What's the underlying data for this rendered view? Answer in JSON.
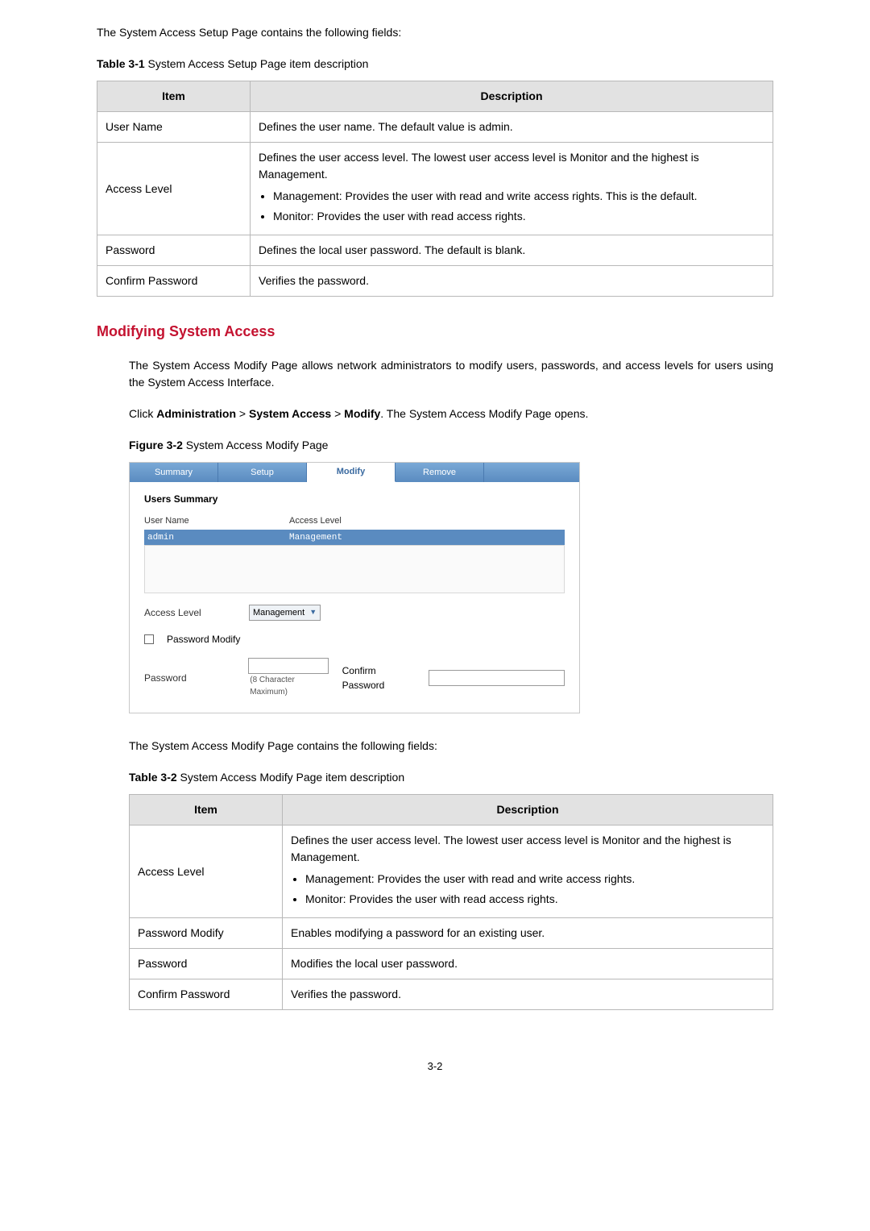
{
  "intro1": "The System Access Setup Page contains the following fields:",
  "tbl1_caption_strong": "Table 3-1",
  "tbl1_caption_rest": " System Access Setup Page item description",
  "col_item": "Item",
  "col_desc": "Description",
  "t1": {
    "r0": {
      "item": "User Name",
      "desc": "Defines the user name. The default value is admin."
    },
    "r1": {
      "item": "Access Level",
      "desc_p1": "Defines the user access level. The lowest user access level is Monitor and the highest is Management.",
      "b0": "Management: Provides the user with read and write access rights. This is the default.",
      "b1": "Monitor: Provides the user with read access rights."
    },
    "r2": {
      "item": "Password",
      "desc": "Defines the local user password. The default is blank."
    },
    "r3": {
      "item": "Confirm Password",
      "desc": "Verifies the password."
    }
  },
  "section_heading": "Modifying System Access",
  "section_para1": "The System Access Modify Page allows network administrators to modify users, passwords, and access levels for users using the System Access Interface.",
  "click_prefix": "Click ",
  "nav1": "Administration",
  "nav_sep": " > ",
  "nav2": "System Access",
  "nav3": "Modify",
  "click_suffix": ". The System Access Modify Page opens.",
  "fig_caption_strong": "Figure 3-2",
  "fig_caption_rest": " System Access Modify Page",
  "fig": {
    "tab0": "Summary",
    "tab1": "Setup",
    "tab2": "Modify",
    "tab3": "Remove",
    "heading": "Users Summary",
    "col0": "User Name",
    "col1": "Access Level",
    "row0_user": "admin",
    "row0_level": "Management",
    "lbl_access": "Access Level",
    "select_val": "Management",
    "lbl_pwd_modify": "Password Modify",
    "lbl_pwd": "Password",
    "note_maxchar": "(8 Character Maximum)",
    "lbl_confirm": "Confirm Password"
  },
  "intro2": "The System Access Modify Page contains the following fields:",
  "tbl2_caption_strong": "Table 3-2",
  "tbl2_caption_rest": " System Access Modify Page item description",
  "t2": {
    "r0": {
      "item": "Access Level",
      "desc_p1": "Defines the user access level. The lowest user access level is Monitor and the highest is Management.",
      "b0": "Management: Provides the user with read and write access rights.",
      "b1": "Monitor: Provides the user with read access rights."
    },
    "r1": {
      "item": "Password Modify",
      "desc": "Enables modifying a password for an existing user."
    },
    "r2": {
      "item": "Password",
      "desc": "Modifies the local user password."
    },
    "r3": {
      "item": "Confirm Password",
      "desc": "Verifies the password."
    }
  },
  "page_num": "3-2"
}
